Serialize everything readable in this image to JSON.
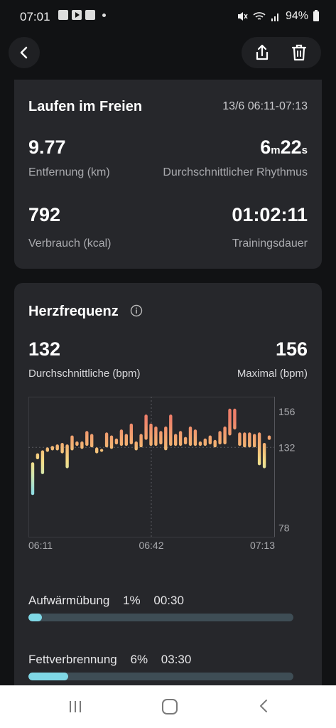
{
  "status_bar": {
    "time": "07:01",
    "battery": "94%"
  },
  "activity": {
    "title": "Laufen im Freien",
    "time_range": "13/6 06:11-07:13",
    "distance_value": "9.77",
    "distance_label": "Entfernung (km)",
    "pace_min": "6",
    "pace_min_unit": "m",
    "pace_sec": "22",
    "pace_sec_unit": "s",
    "pace_label": "Durchschnittlicher Rhythmus",
    "calories_value": "792",
    "calories_label": "Verbrauch (kcal)",
    "duration_value": "01:02:11",
    "duration_label": "Trainingsdauer"
  },
  "heart_rate": {
    "title": "Herzfrequenz",
    "avg_value": "132",
    "avg_label": "Durchschnittliche (bpm)",
    "max_value": "156",
    "max_label": "Maximal (bpm)"
  },
  "chart_data": {
    "type": "bar",
    "y_ticks": [
      "156",
      "132",
      "78"
    ],
    "x_ticks": [
      "06:11",
      "06:42",
      "07:13"
    ],
    "ylim": [
      72,
      166
    ],
    "bars": [
      [
        100,
        122
      ],
      [
        124,
        128
      ],
      [
        114,
        130
      ],
      [
        129,
        132
      ],
      [
        130,
        133
      ],
      [
        130,
        134
      ],
      [
        128,
        135
      ],
      [
        118,
        134
      ],
      [
        130,
        140
      ],
      [
        133,
        136
      ],
      [
        131,
        136
      ],
      [
        133,
        143
      ],
      [
        132,
        141
      ],
      [
        128,
        132
      ],
      [
        129,
        131
      ],
      [
        132,
        142
      ],
      [
        131,
        140
      ],
      [
        134,
        138
      ],
      [
        133,
        144
      ],
      [
        133,
        141
      ],
      [
        134,
        148
      ],
      [
        130,
        136
      ],
      [
        132,
        141
      ],
      [
        137,
        154
      ],
      [
        133,
        148
      ],
      [
        133,
        146
      ],
      [
        134,
        143
      ],
      [
        130,
        146
      ],
      [
        133,
        154
      ],
      [
        133,
        141
      ],
      [
        133,
        143
      ],
      [
        134,
        139
      ],
      [
        133,
        146
      ],
      [
        133,
        144
      ],
      [
        133,
        136
      ],
      [
        133,
        138
      ],
      [
        134,
        140
      ],
      [
        132,
        137
      ],
      [
        134,
        143
      ],
      [
        134,
        146
      ],
      [
        140,
        158
      ],
      [
        144,
        158
      ],
      [
        133,
        142
      ],
      [
        132,
        142
      ],
      [
        132,
        142
      ],
      [
        132,
        141
      ],
      [
        120,
        142
      ],
      [
        118,
        135
      ],
      [
        137,
        140
      ]
    ]
  },
  "zones": [
    {
      "name": "Aufwärmübung",
      "percent": "1%",
      "time": "00:30",
      "fill": 0.01
    },
    {
      "name": "Fettverbrennung",
      "percent": "6%",
      "time": "03:30",
      "fill": 0.06
    }
  ],
  "icons": {
    "back": "chevron-left-icon",
    "share": "share-icon",
    "delete": "trash-icon",
    "info": "info-icon"
  }
}
